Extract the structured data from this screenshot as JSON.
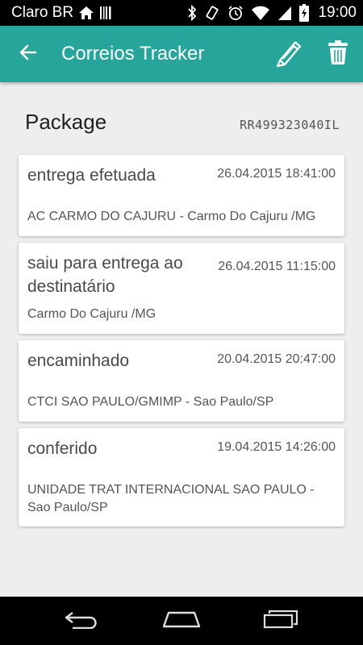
{
  "status_bar": {
    "carrier": "Claro BR",
    "time": "19:00",
    "icons": [
      "home-icon",
      "barcode-icon",
      "bluetooth-icon",
      "vibrate-icon",
      "alarm-icon",
      "wifi-icon",
      "signal-icon",
      "battery-icon"
    ]
  },
  "app_bar": {
    "title": "Correios Tracker",
    "background": "#26a69a",
    "icons": [
      "back-arrow-icon",
      "pencil-icon",
      "trash-icon"
    ]
  },
  "package": {
    "title": "Package",
    "code": "RR499323040IL"
  },
  "events": [
    {
      "status": "entrega efetuada",
      "date": "26.04.2015 18:41:00",
      "location": "AC CARMO DO CAJURU - Carmo Do Cajuru /MG"
    },
    {
      "status": "saiu para entrega ao destinatário",
      "date": "26.04.2015 11:15:00",
      "location": "Carmo Do Cajuru /MG"
    },
    {
      "status": "encaminhado",
      "date": "20.04.2015 20:47:00",
      "location": "CTCI SAO PAULO/GMIMP - Sao Paulo/SP"
    },
    {
      "status": "conferido",
      "date": "19.04.2015 14:26:00",
      "location": "UNIDADE TRAT INTERNACIONAL SAO PAULO - Sao Paulo/SP"
    }
  ],
  "nav_bar": {
    "icons": [
      "back-nav-icon",
      "home-nav-icon",
      "recents-nav-icon"
    ]
  }
}
